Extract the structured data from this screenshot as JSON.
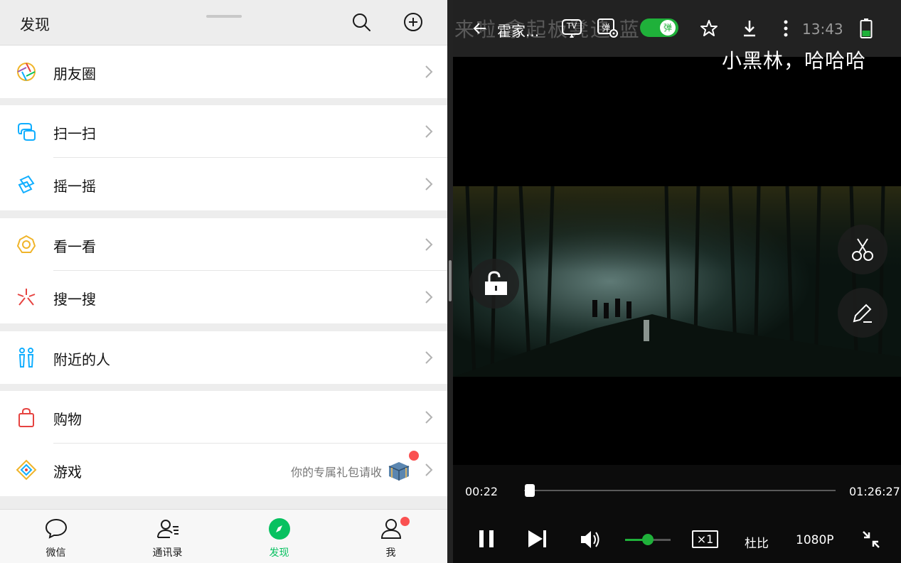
{
  "wechat": {
    "header": {
      "title": "发现"
    },
    "menu": {
      "moments": {
        "label": "朋友圈"
      },
      "scan": {
        "label": "扫一扫"
      },
      "shake": {
        "label": "摇一摇"
      },
      "top_stories": {
        "label": "看一看"
      },
      "search": {
        "label": "搜一搜"
      },
      "nearby": {
        "label": "附近的人"
      },
      "shopping": {
        "label": "购物"
      },
      "games": {
        "label": "游戏",
        "extra": "你的专属礼包请收"
      }
    },
    "tabs": [
      {
        "label": "微信",
        "icon": "chat-icon"
      },
      {
        "label": "通讯录",
        "icon": "contacts-icon"
      },
      {
        "label": "发现",
        "icon": "discover-icon",
        "active": true
      },
      {
        "label": "我",
        "icon": "me-icon",
        "badge": true
      }
    ],
    "colors": {
      "accent": "#07c160",
      "badge": "#fa5151"
    }
  },
  "player": {
    "title": "霍家...",
    "clock": "13:43",
    "danmu_toggle": {
      "label": "弹",
      "on": true
    },
    "cast_label": "TV",
    "danmu_settings_label": "弹",
    "danmu_back": "来啦 拿起板凳追 蓝",
    "danmu_front": "小黑林，哈哈哈",
    "current_time": "00:22",
    "total_time": "01:26:27",
    "progress": 0.004,
    "volume": 0.5,
    "speed": "×1",
    "audio": "杜比",
    "quality": "1080P",
    "colors": {
      "accent": "#1fb13a"
    }
  }
}
